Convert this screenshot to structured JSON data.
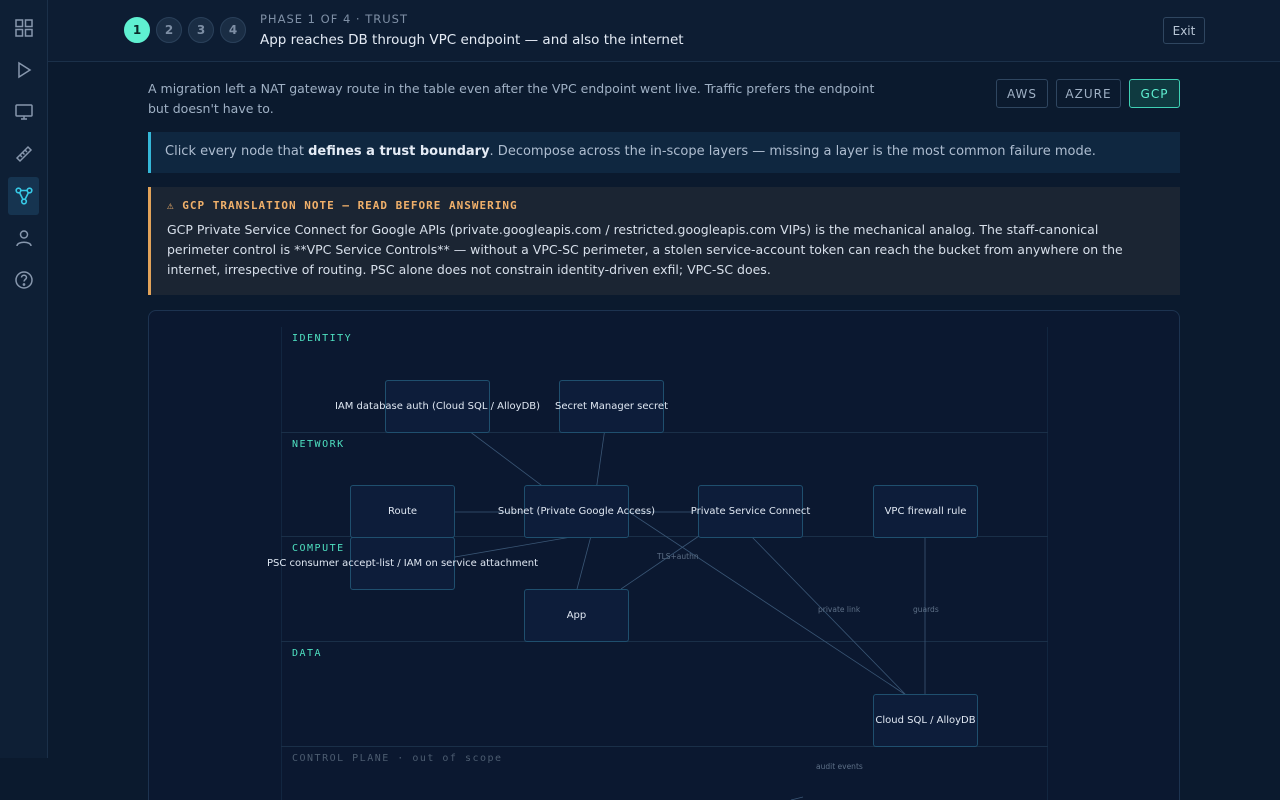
{
  "rail": {
    "items": [
      {
        "icon": "grid-icon"
      },
      {
        "icon": "play-icon"
      },
      {
        "icon": "monitor-icon"
      },
      {
        "icon": "ruler-icon"
      },
      {
        "icon": "graph-icon",
        "active": true
      },
      {
        "icon": "user-icon"
      },
      {
        "icon": "help-icon"
      }
    ]
  },
  "header": {
    "steps": [
      "1",
      "2",
      "3",
      "4"
    ],
    "active_step": "1",
    "phase": "PHASE 1 OF 4 · TRUST",
    "title": "App reaches DB through VPC endpoint — and also the internet",
    "exit_label": "Exit"
  },
  "description": "A migration left a NAT gateway route in the table even after the VPC endpoint went live. Traffic prefers the endpoint but doesn't have to.",
  "clouds": {
    "options": [
      "AWS",
      "AZURE",
      "GCP"
    ],
    "selected": "GCP"
  },
  "instruction": {
    "prefix": "Click every node that ",
    "bold": "defines a trust boundary",
    "suffix": ". Decompose across the in-scope layers — missing a layer is the most common failure mode."
  },
  "note": {
    "title": "⚠ GCP TRANSLATION NOTE — READ BEFORE ANSWERING",
    "body": "GCP Private Service Connect for Google APIs (private.googleapis.com / restricted.googleapis.com VIPs) is the mechanical analog. The staff-canonical perimeter control is **VPC Service Controls** — without a VPC-SC perimeter, a stolen service-account token can reach the bucket from anywhere on the internet, irrespective of routing. PSC alone does not constrain identity-driven exfil; VPC-SC does."
  },
  "diagram": {
    "layers": {
      "identity": "IDENTITY",
      "network": "NETWORK",
      "compute": "COMPUTE",
      "data": "DATA",
      "control": "CONTROL PLANE · out of scope"
    },
    "nodes": {
      "iam_db_auth": "IAM database auth (Cloud SQL / AlloyDB)",
      "secret": "Secret Manager secret",
      "route": "Route",
      "subnet": "Subnet (Private Google Access)",
      "psc": "Private Service Connect",
      "firewall": "VPC firewall rule",
      "psc_consumer": "PSC consumer accept-list / IAM on service attachment",
      "app": "App",
      "cloudsql": "Cloud SQL / AlloyDB"
    },
    "edge_labels": {
      "tls": "TLS+authn",
      "private_link": "private link",
      "guards": "guards",
      "audit": "audit events"
    }
  },
  "colors": {
    "accent": "#5ff0d1",
    "warning": "#f0b06a",
    "info": "#35b7d8"
  }
}
